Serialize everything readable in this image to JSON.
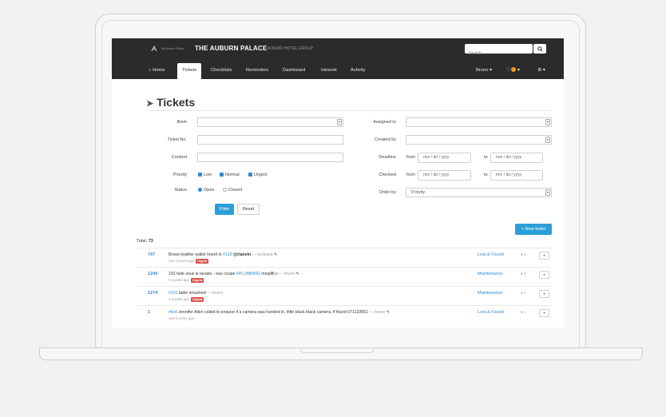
{
  "brand": {
    "logo_text": "The Auburn Palace",
    "name": "THE AUBURN PALACE",
    "subtitle": "A DEMO HOTEL GROUP"
  },
  "search": {
    "placeholder": "Search..."
  },
  "nav": {
    "tabs": [
      {
        "label": "Home",
        "icon": "home-icon"
      },
      {
        "label": "Tickets",
        "active": true
      },
      {
        "label": "Checklists"
      },
      {
        "label": "Reminders"
      },
      {
        "label": "Dashboard"
      },
      {
        "label": "Intranet"
      },
      {
        "label": "Activity"
      }
    ],
    "user_label": "Bruno",
    "notification_count": "1"
  },
  "page": {
    "title": "Tickets"
  },
  "filters": {
    "book_label": "Book",
    "ticket_no_label": "Ticket No.",
    "content_label": "Content",
    "priority_label": "Priority",
    "priority_options": [
      "Low",
      "Normal",
      "Urgent"
    ],
    "status_label": "Status",
    "status_options": [
      "Open",
      "Closed"
    ],
    "assigned_to_label": "Assigned to",
    "created_by_label": "Created by",
    "deadline_label": "Deadline",
    "checked_label": "Checked",
    "from_label": "from",
    "to_label": "to",
    "date_placeholder": "mm / dd / yyyy",
    "order_by_label": "Order by",
    "order_by_value": "Priority",
    "filter_button": "Filter",
    "reset_button": "Reset"
  },
  "new_ticket_button": "+ New ticket",
  "total": {
    "label": "Total:",
    "count": "73"
  },
  "tickets": [
    {
      "id": "747",
      "text_before": "Brown leather wallet found in ",
      "tag": "#120",
      "mention": " @rlanvin",
      "author": " — bertrand",
      "meta": "over 2 years ago",
      "urgent": "Urgent",
      "category": "Lost & Found",
      "comments": "2"
    },
    {
      "id": "1244",
      "text_before": "102 fuite sous le lavabo - eau coupé ",
      "tag": "#PLUMBING",
      "mention": " msqdlfj s",
      "author": " — bruno",
      "meta": "9 months ago",
      "urgent": "Urgent",
      "category": "Maintenance",
      "comments": "3"
    },
    {
      "id": "1274",
      "text_before": "",
      "tag": "#101",
      "mention": " table smashed",
      "author": " — bruno",
      "meta": "4 months ago",
      "urgent": "Urgent",
      "category": "Maintenance",
      "comments": "2"
    },
    {
      "id": "1",
      "text_before": "",
      "tag": "#lost",
      "mention": " Jennifer Allen called to enquire if a camera was handed in, little black black camera, if found 071133551",
      "author": " — bruno",
      "meta": "over 5 years ago",
      "urgent": "",
      "category": "Lost & Found",
      "comments": "1"
    }
  ]
}
